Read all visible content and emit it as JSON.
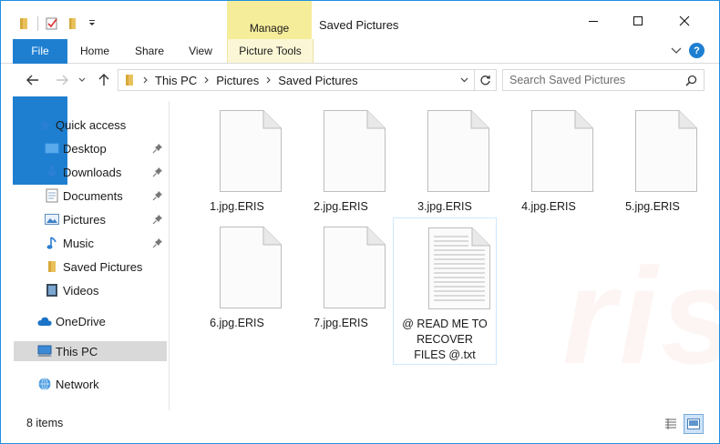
{
  "window": {
    "title": "Saved Pictures",
    "manage_label": "Manage"
  },
  "ribbon": {
    "tabs": [
      {
        "label": "File"
      },
      {
        "label": "Home"
      },
      {
        "label": "Share"
      },
      {
        "label": "View"
      },
      {
        "label": "Picture Tools"
      }
    ]
  },
  "address": {
    "crumbs": [
      "This PC",
      "Pictures",
      "Saved Pictures"
    ]
  },
  "search": {
    "placeholder": "Search Saved Pictures"
  },
  "navpane": {
    "items": [
      {
        "label": "Quick access",
        "icon": "star-icon"
      },
      {
        "label": "Desktop",
        "icon": "desktop-folder-icon",
        "pinned": true
      },
      {
        "label": "Downloads",
        "icon": "download-arrow-icon",
        "pinned": true
      },
      {
        "label": "Documents",
        "icon": "documents-icon",
        "pinned": true
      },
      {
        "label": "Pictures",
        "icon": "pictures-icon",
        "pinned": true
      },
      {
        "label": "Music",
        "icon": "music-note-icon",
        "pinned": true
      },
      {
        "label": "Saved Pictures",
        "icon": "folder-icon"
      },
      {
        "label": "Videos",
        "icon": "videos-icon"
      },
      {
        "label": "OneDrive",
        "icon": "cloud-icon"
      },
      {
        "label": "This PC",
        "icon": "computer-icon",
        "selected": true
      },
      {
        "label": "Network",
        "icon": "network-icon"
      }
    ]
  },
  "files": [
    {
      "name": "1.jpg.ERIS"
    },
    {
      "name": "2.jpg.ERIS"
    },
    {
      "name": "3.jpg.ERIS"
    },
    {
      "name": "4.jpg.ERIS"
    },
    {
      "name": "5.jpg.ERIS"
    },
    {
      "name": "6.jpg.ERIS"
    },
    {
      "name": "7.jpg.ERIS"
    },
    {
      "name": "@ READ ME TO RECOVER FILES @.txt",
      "type": "text"
    }
  ],
  "status": {
    "count": "8 items"
  },
  "colors": {
    "accent": "#1e7fd1",
    "manage": "#f6ed9b",
    "selection": "#cde8ff"
  },
  "watermark": {
    "text": "risk.com"
  }
}
